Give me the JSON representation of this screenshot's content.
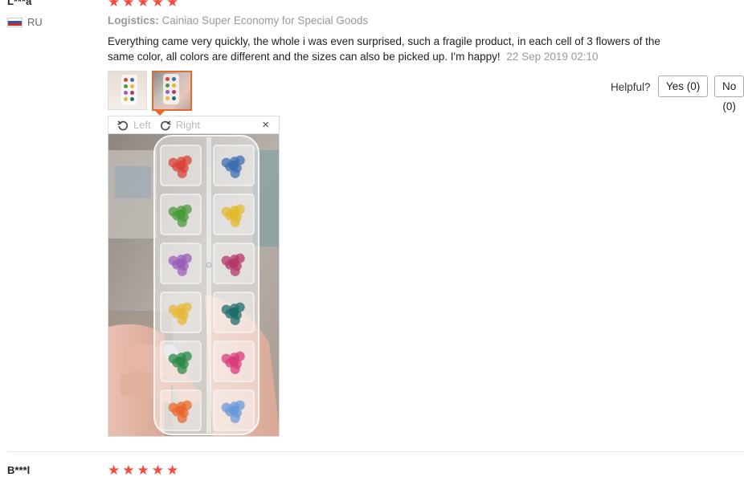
{
  "review1": {
    "reviewer": "L***a",
    "country": "RU",
    "stars": 5,
    "logistics_label": "Logistics:",
    "logistics_value": "Cainiao Super Economy for Special Goods",
    "text": "Everything came very quickly, the whole i was even surprised, such a fragile product, in each cell of 3 flowers of the same color, all colors are different and the sizes can also be picked up. I'm happy!",
    "date": "22 Sep 2019 02:10",
    "helpful_label": "Helpful?",
    "yes_label": "Yes (0)",
    "no_label": "No (0)",
    "viewer": {
      "rotate_left_label": "Left",
      "rotate_right_label": "Right",
      "close_label": "×"
    }
  },
  "review2": {
    "reviewer": "B***l",
    "stars": 5
  },
  "colors": {
    "star": "#f44b40",
    "active_thumb_border": "#e46a32",
    "flower_colors": [
      "#d9443a",
      "#3b6fb0",
      "#4a9a3c",
      "#e2b92c",
      "#9a5fb8",
      "#b23a6a",
      "#e6b93a",
      "#1f6e6c",
      "#2e8a4a",
      "#d83c7a",
      "#e86a2e",
      "#6a9ad8"
    ]
  }
}
